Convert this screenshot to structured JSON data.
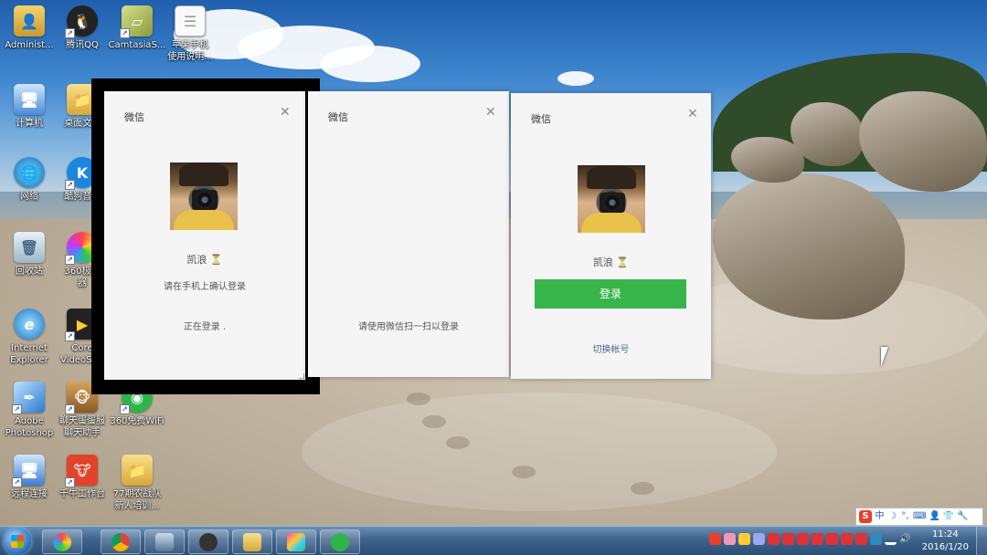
{
  "desktop": {
    "icons": [
      {
        "name": "administrator-folder-icon",
        "label": "Administ..."
      },
      {
        "name": "tencent-qq-icon",
        "label": "腾讯QQ"
      },
      {
        "name": "camtasia-icon",
        "label": "CamtasiaS..."
      },
      {
        "name": "apple-doc-icon",
        "label": "苹果手机",
        "label2": "使用说明..."
      },
      {
        "name": "computer-icon",
        "label": "计算机"
      },
      {
        "name": "desktop-folder-icon",
        "label": "桌面文..."
      },
      {
        "name": "network-icon",
        "label": "网络"
      },
      {
        "name": "kugou-icon",
        "label": "酷狗音..."
      },
      {
        "name": "recycle-bin-icon",
        "label": "回收站"
      },
      {
        "name": "360-icon",
        "label": "360极速",
        "label2": "器"
      },
      {
        "name": "ie-icon",
        "label": "Internet",
        "label2": "Explorer"
      },
      {
        "name": "corevideo-icon",
        "label": "Core",
        "label2": "VideoSt..."
      },
      {
        "name": "photoshop-icon",
        "label": "Adobe",
        "label2": "Photoshop"
      },
      {
        "name": "chat-helper-icon",
        "label": "聊天蛋蛋服",
        "label2": "聊天助手"
      },
      {
        "name": "360-wifi-icon",
        "label": "360免费WiFi"
      },
      {
        "name": "remote-desktop-icon",
        "label": "远程连接"
      },
      {
        "name": "qianniu-icon",
        "label": "千牛工作台"
      },
      {
        "name": "folder-77-icon",
        "label": "77期农战队",
        "label2": "新人培训..."
      }
    ]
  },
  "windows": {
    "w1": {
      "title": "微信",
      "close": "✕",
      "nickname": "凯浪",
      "hint": "请在手机上确认登录",
      "status": "正在登录 ."
    },
    "w2": {
      "title": "微信",
      "close": "✕",
      "hint": "请使用微信扫一扫以登录"
    },
    "w3": {
      "title": "微信",
      "close": "✕",
      "nickname": "凯浪",
      "login_label": "登录",
      "switch_label": "切换帐号"
    }
  },
  "ime": {
    "logo": "S",
    "mode": "中"
  },
  "taskbar": {
    "apps": [
      "chrome",
      "photoshop",
      "camtasia-recorder",
      "explorer",
      "word-app",
      "wechat"
    ],
    "clock": {
      "time": "11:24",
      "date": "2016/1/20"
    }
  },
  "colors": {
    "wechat_green": "#38b54a",
    "link_blue": "#4b6a8c"
  }
}
